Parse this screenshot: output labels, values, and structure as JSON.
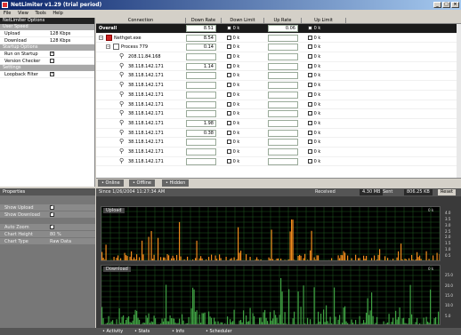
{
  "window": {
    "title": "NetLimiter v1.29 (trial period)",
    "btn_min": "_",
    "btn_max": "□",
    "btn_close": "×"
  },
  "menu": [
    "File",
    "View",
    "Tools",
    "Help"
  ],
  "options_panel": {
    "title": "NetLimiter Options",
    "sections": [
      {
        "header": "User Speed",
        "rows": [
          {
            "label": "Upload",
            "value": "128 Kbps"
          },
          {
            "label": "Download",
            "value": "128 Kbps"
          }
        ]
      },
      {
        "header": "Startup Options",
        "rows": [
          {
            "label": "Run on Startup",
            "checked": true
          },
          {
            "label": "Version Checker",
            "checked": false
          }
        ]
      },
      {
        "header": "Settings",
        "rows": [
          {
            "label": "Loopback Filter",
            "checked": true
          }
        ]
      }
    ]
  },
  "properties_panel": {
    "title": "Properties",
    "rows1": [
      {
        "label": "Show Upload",
        "checked": true
      },
      {
        "label": "Show Download",
        "checked": true
      }
    ],
    "rows2": [
      {
        "label": "Auto Zoom",
        "checked": true
      },
      {
        "label": "Chart Height",
        "value": "80 %"
      },
      {
        "label": "Chart Type",
        "value": "Raw Data"
      }
    ]
  },
  "table": {
    "columns": [
      "Connection",
      "Down Rate",
      "Down Limit",
      "Up Rate",
      "Up Limit"
    ],
    "unit": "0 k",
    "overall": {
      "name": "Overall",
      "down": "8.51",
      "up": "0.06"
    },
    "app": {
      "name": "Nethget.exe",
      "down": "8.54"
    },
    "process": {
      "name": "Process 779",
      "down": "0.14"
    },
    "connections": [
      {
        "ip": "208.11.84.168",
        "down": ""
      },
      {
        "ip": "38.118.142.171",
        "down": "1.14"
      },
      {
        "ip": "38.118.142.171",
        "down": ""
      },
      {
        "ip": "38.118.142.171",
        "down": ""
      },
      {
        "ip": "38.118.142.171",
        "down": ""
      },
      {
        "ip": "38.118.142.171",
        "down": ""
      },
      {
        "ip": "38.118.142.171",
        "down": ""
      },
      {
        "ip": "38.118.142.171",
        "down": "1.98"
      },
      {
        "ip": "38.118.142.171",
        "down": "0.38"
      },
      {
        "ip": "38.118.142.171",
        "down": ""
      },
      {
        "ip": "38.118.142.171",
        "down": ""
      },
      {
        "ip": "38.118.142.171",
        "down": ""
      }
    ]
  },
  "filter_tabs": [
    "• Online",
    "• Offline",
    "• Hidden"
  ],
  "graph_header": {
    "since": "Since 1/26/2004 11:27:34 AM",
    "received_label": "Received",
    "received": "4.30 MB",
    "sent_label": "Sent",
    "sent": "806.25 KB",
    "reset": "Reset"
  },
  "upload_chart": {
    "label": "Upload",
    "unit_label": "0 k",
    "ticks": [
      "4.0",
      "3.5",
      "3.0",
      "2.5",
      "2.0",
      "1.5",
      "1.0",
      "0.5"
    ]
  },
  "download_chart": {
    "label": "Download",
    "unit_label": "0 k",
    "ticks": [
      "25.0",
      "20.0",
      "15.0",
      "10.0",
      "5.0"
    ]
  },
  "bottom_tabs": [
    "• Activity",
    "• Stats",
    "• Info",
    "• Scheduler"
  ],
  "colors": {
    "upload": "#f08a1c",
    "download": "#3fa043",
    "grid": "#1e5a1e",
    "selection": "#1a1a1a"
  }
}
